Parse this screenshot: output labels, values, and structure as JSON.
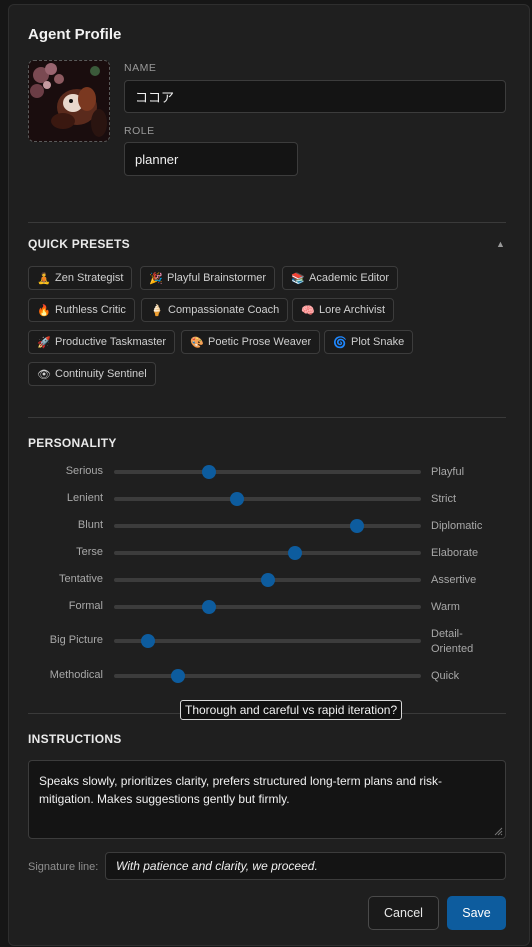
{
  "dialog": {
    "title": "Agent Profile"
  },
  "profile": {
    "name_label": "NAME",
    "name_value": "ココア",
    "role_label": "ROLE",
    "role_value": "planner"
  },
  "presets": {
    "title": "QUICK PRESETS",
    "items": [
      {
        "label": "Zen Strategist",
        "icon": "🧘"
      },
      {
        "label": "Playful Brainstormer",
        "icon": "🎉"
      },
      {
        "label": "Academic Editor",
        "icon": "📚"
      },
      {
        "label": "Ruthless Critic",
        "icon": "🔥"
      },
      {
        "label": "Compassionate Coach",
        "icon": "🍦"
      },
      {
        "label": "Lore Archivist",
        "icon": "🧠"
      },
      {
        "label": "Productive Taskmaster",
        "icon": "🚀"
      },
      {
        "label": "Poetic Prose Weaver",
        "icon": "🎨"
      },
      {
        "label": "Plot Snake",
        "icon": "🌀"
      },
      {
        "label": "Continuity Sentinel",
        "icon": "👁"
      }
    ]
  },
  "personality": {
    "title": "PERSONALITY",
    "sliders": [
      {
        "left": "Serious",
        "right": "Playful",
        "value": 0.31
      },
      {
        "left": "Lenient",
        "right": "Strict",
        "value": 0.4
      },
      {
        "left": "Blunt",
        "right": "Diplomatic",
        "value": 0.79
      },
      {
        "left": "Terse",
        "right": "Elaborate",
        "value": 0.59
      },
      {
        "left": "Tentative",
        "right": "Assertive",
        "value": 0.5
      },
      {
        "left": "Formal",
        "right": "Warm",
        "value": 0.31
      },
      {
        "left": "Big Picture",
        "right": "Detail-\nOriented",
        "value": 0.11
      },
      {
        "left": "Methodical",
        "right": "Quick",
        "value": 0.21
      }
    ],
    "tooltip": "Thorough and careful vs rapid iteration?"
  },
  "instructions": {
    "title": "INSTRUCTIONS",
    "text": "Speaks slowly, prioritizes clarity, prefers structured long-term plans and risk-mitigation. Makes suggestions gently but firmly.",
    "signature_label": "Signature line:",
    "signature_value": "With patience and clarity, we proceed."
  },
  "actions": {
    "cancel": "Cancel",
    "save": "Save"
  },
  "colors": {
    "accent": "#0d5c9e",
    "panel": "#1f1f1f",
    "input_bg": "#141414"
  }
}
